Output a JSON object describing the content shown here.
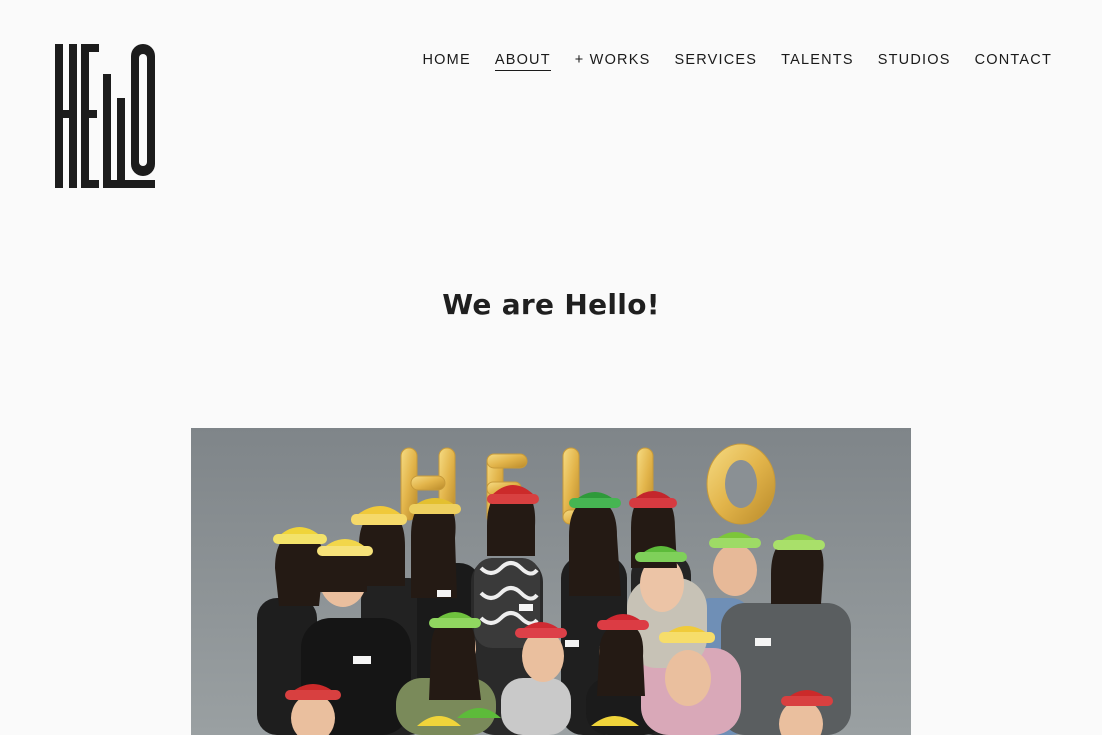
{
  "logo": {
    "text": "HELLO"
  },
  "nav": {
    "items": [
      {
        "label": "HOME",
        "active": false
      },
      {
        "label": "ABOUT",
        "active": true
      },
      {
        "label": "+ WORKS",
        "active": false
      },
      {
        "label": "SERVICES",
        "active": false
      },
      {
        "label": "TALENTS",
        "active": false
      },
      {
        "label": "STUDIOS",
        "active": false
      },
      {
        "label": "CONTACT",
        "active": false
      }
    ]
  },
  "main": {
    "heading": "We are Hello!"
  },
  "hero": {
    "balloon_letters": [
      "H",
      "E",
      "L",
      "L",
      "O"
    ],
    "colors": {
      "backdrop": "#8b9093",
      "balloon_gold": "#e8c25a"
    }
  }
}
